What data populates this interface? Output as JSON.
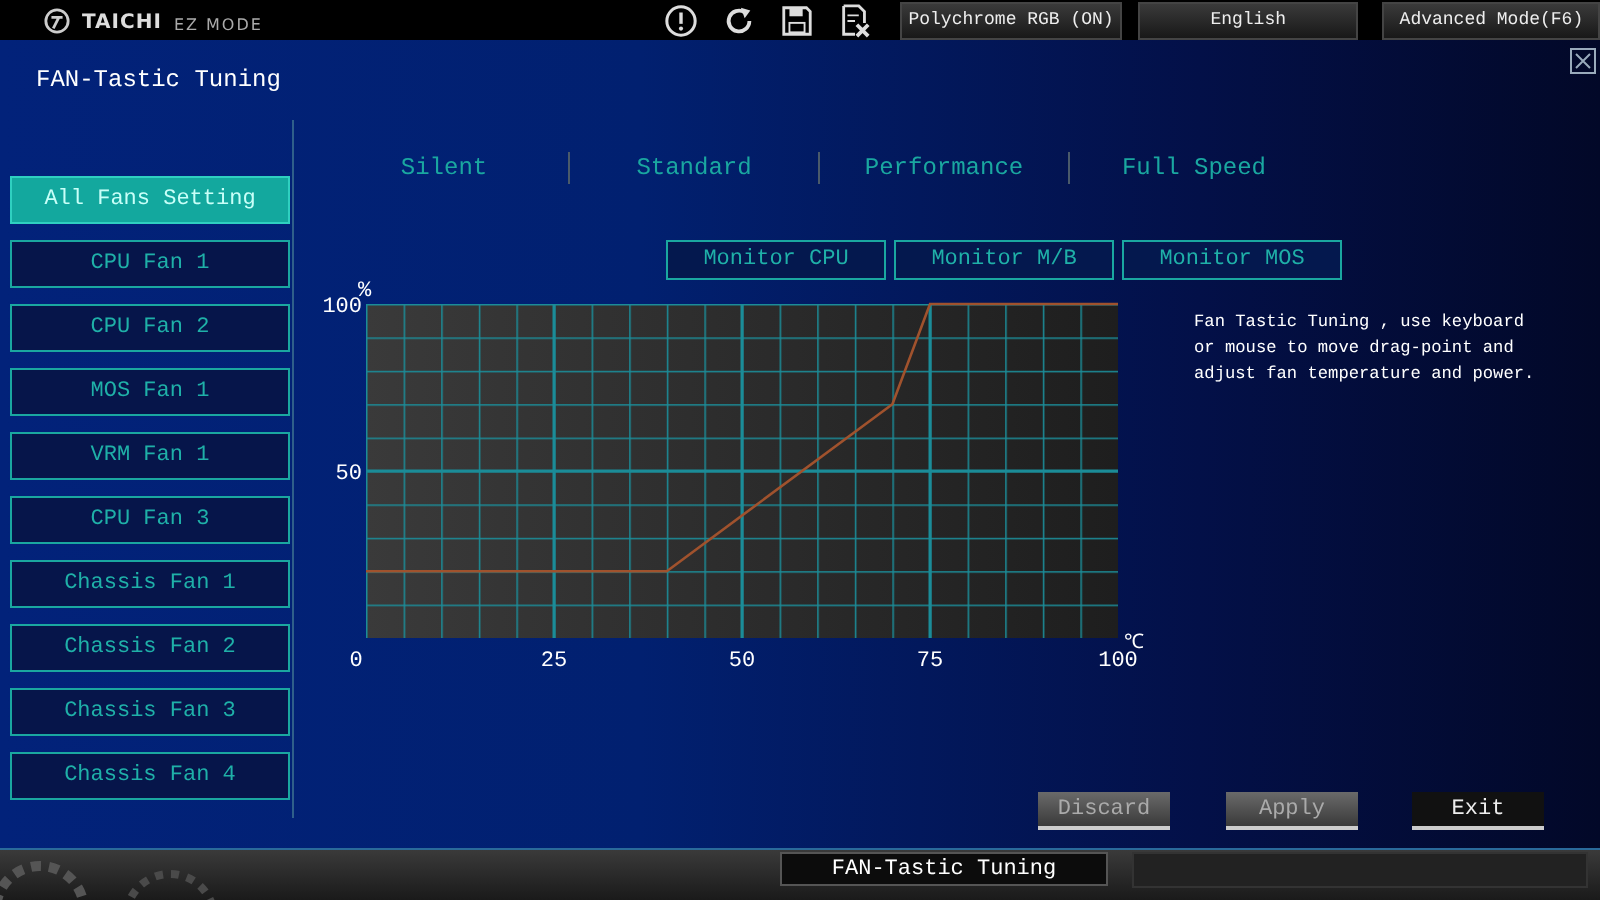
{
  "top_bar": {
    "logo": "TAICHI",
    "mode": "EZ MODE",
    "buttons": [
      "Polychrome RGB (ON)",
      "English",
      "Advanced Mode(F6)"
    ]
  },
  "window": {
    "title": "FAN-Tastic Tuning"
  },
  "fans": [
    {
      "label": "All Fans Setting",
      "selected": true
    },
    {
      "label": "CPU Fan 1",
      "selected": false
    },
    {
      "label": "CPU Fan 2",
      "selected": false
    },
    {
      "label": "MOS Fan 1",
      "selected": false
    },
    {
      "label": "VRM Fan 1",
      "selected": false
    },
    {
      "label": "CPU Fan 3",
      "selected": false
    },
    {
      "label": "Chassis Fan 1",
      "selected": false
    },
    {
      "label": "Chassis Fan 2",
      "selected": false
    },
    {
      "label": "Chassis Fan 3",
      "selected": false
    },
    {
      "label": "Chassis Fan 4",
      "selected": false
    }
  ],
  "presets": [
    "Silent",
    "Standard",
    "Performance",
    "Full Speed"
  ],
  "monitors": [
    "Monitor CPU",
    "Monitor M/B",
    "Monitor MOS"
  ],
  "chart_data": {
    "type": "line",
    "grid": true,
    "ylabel": "%",
    "xlabel": "℃",
    "xlim": [
      0,
      100
    ],
    "ylim": [
      0,
      100
    ],
    "xticks": [
      0,
      25,
      50,
      75,
      100
    ],
    "yticks": [
      50,
      100
    ],
    "series": [
      {
        "color": "#a0522d",
        "x": [
          0,
          40,
          70,
          75,
          100
        ],
        "values": [
          20,
          20,
          70,
          100,
          100
        ]
      }
    ]
  },
  "description": "Fan Tastic Tuning , use keyboard or mouse to move drag-point and adjust fan temperature and power.",
  "actions": [
    {
      "label": "Discard",
      "disabled": true
    },
    {
      "label": "Apply",
      "disabled": true
    },
    {
      "label": "Exit",
      "disabled": false
    }
  ],
  "bottom_bar": {
    "tab": "FAN-Tastic Tuning"
  }
}
